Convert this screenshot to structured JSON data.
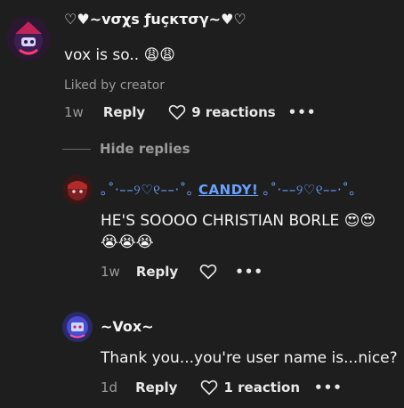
{
  "comment": {
    "username": "♡♥~vσχs ƒuçкτσγ~♥♡",
    "text": "vox is so..",
    "emoji": "😩😩",
    "liked_by": "Liked by creator",
    "time": "1w",
    "reply_label": "Reply",
    "reactions_label": "9 reactions",
    "more_label": "•••"
  },
  "hide_replies_label": "Hide replies",
  "replies": [
    {
      "username_pre": "｡˚·––୨♡୧––·˚｡ ",
      "username_core": "CANDY!",
      "username_post": " ｡˚·––୨♡୧––·˚｡",
      "text": "HE'S SOOOO CHRISTIAN BORLE",
      "emoji_inline": "😍😍",
      "emoji_line2": "😭😭😭",
      "time": "1w",
      "reply_label": "Reply",
      "more_label": "•••"
    },
    {
      "username": "~Vox~",
      "text": "Thank you...you're user name is...nice?",
      "time": "1d",
      "reply_label": "Reply",
      "reactions_label": "1 reaction",
      "more_label": "•••"
    }
  ],
  "colors": {
    "background": "#1e1e1e",
    "text": "#f4f4f4",
    "muted": "#9a9a9a",
    "candy_accent": "#6aa0ff"
  }
}
